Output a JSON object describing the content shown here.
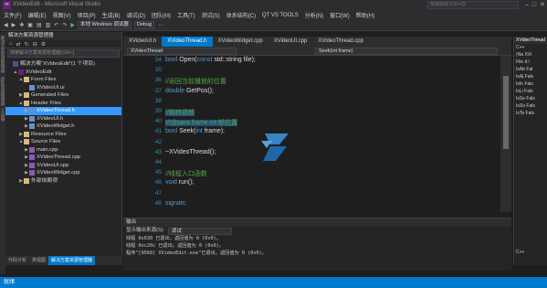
{
  "window": {
    "title": "XVideoEdit - Microsoft Visual Studio",
    "quick_launch_placeholder": "快速启动 (Ctrl+Q)"
  },
  "menu": [
    "文件(F)",
    "编辑(E)",
    "视图(V)",
    "项目(P)",
    "生成(B)",
    "调试(D)",
    "团队(M)",
    "工具(T)",
    "测试(S)",
    "体系结构(C)",
    "QT VS TOOLS",
    "分析(N)",
    "窗口(W)",
    "帮助(H)"
  ],
  "toolbar": {
    "debugger": "本地 Windows 调试器",
    "config": "Debug"
  },
  "left_strip": [
    "解决方案资源管理器",
    "团队资源管理器",
    "工具箱"
  ],
  "solution_explorer": {
    "header": "解决方案资源管理器",
    "search_placeholder": "搜索解决方案资源管理器(Ctrl+;)",
    "items": [
      {
        "label": "解决方案\"XVideoEdit\"(1 个项目)",
        "indent": 0,
        "icon": "sln",
        "arrow": ""
      },
      {
        "label": "XVideoEdit",
        "indent": 1,
        "icon": "proj",
        "arrow": "▲"
      },
      {
        "label": "Form Files",
        "indent": 2,
        "icon": "folder",
        "arrow": "▲"
      },
      {
        "label": "XVideoUI.ui",
        "indent": 3,
        "icon": "hfile",
        "arrow": ""
      },
      {
        "label": "Generated Files",
        "indent": 2,
        "icon": "folder",
        "arrow": "▶"
      },
      {
        "label": "Header Files",
        "indent": 2,
        "icon": "folder",
        "arrow": "▲"
      },
      {
        "label": "XVideoThread.h",
        "indent": 3,
        "icon": "hfile",
        "arrow": "▶",
        "selected": true
      },
      {
        "label": "XVideoUI.h",
        "indent": 3,
        "icon": "hfile",
        "arrow": "▶"
      },
      {
        "label": "XVideoWidget.h",
        "indent": 3,
        "icon": "hfile",
        "arrow": "▶"
      },
      {
        "label": "Resource Files",
        "indent": 2,
        "icon": "folder",
        "arrow": "▶"
      },
      {
        "label": "Source Files",
        "indent": 2,
        "icon": "folder",
        "arrow": "▲"
      },
      {
        "label": "main.cpp",
        "indent": 3,
        "icon": "cppfile",
        "arrow": "▶"
      },
      {
        "label": "XVideoThread.cpp",
        "indent": 3,
        "icon": "cppfile",
        "arrow": "▶"
      },
      {
        "label": "XVideoUI.cpp",
        "indent": 3,
        "icon": "cppfile",
        "arrow": "▶"
      },
      {
        "label": "XVideoWidget.cpp",
        "indent": 3,
        "icon": "cppfile",
        "arrow": "▶"
      },
      {
        "label": "外部依赖项",
        "indent": 2,
        "icon": "folder",
        "arrow": "▶"
      }
    ],
    "bottom_tabs": [
      "代码分析",
      "类视图",
      "解决方案资源管理器"
    ]
  },
  "tabs": [
    {
      "label": "XVideoUI.h",
      "active": false
    },
    {
      "label": "XVideoThread.h",
      "active": true
    },
    {
      "label": "XVideoWidget.cpp",
      "active": false
    },
    {
      "label": "XVideoUI.cpp",
      "active": false
    },
    {
      "label": "XVideoThread.cpp",
      "active": false
    }
  ],
  "navbar": {
    "scope": "XVideoThread",
    "member": "Seek(int frame)"
  },
  "code_lines": [
    {
      "n": "34",
      "segs": [
        [
          "kw",
          "bool "
        ],
        [
          "",
          "Open("
        ],
        [
          "kw",
          "const "
        ],
        [
          "",
          "std::string file);"
        ]
      ]
    },
    {
      "n": "35",
      "segs": [
        [
          "",
          ""
        ]
      ]
    },
    {
      "n": "36",
      "segs": [
        [
          "cm",
          "//返回当前播放的位置"
        ]
      ]
    },
    {
      "n": "37",
      "segs": [
        [
          "kw",
          "double "
        ],
        [
          "",
          "GetPos();"
        ]
      ]
    },
    {
      "n": "38",
      "segs": [
        [
          "",
          ""
        ]
      ]
    },
    {
      "n": "39",
      "segs": [
        [
          "cm",
          "//跳转视频"
        ]
      ],
      "hl": true
    },
    {
      "n": "40",
      "segs": [
        [
          "cm",
          "///@para frame int 帧位置"
        ]
      ],
      "hl": true
    },
    {
      "n": "41",
      "segs": [
        [
          "kw",
          "bool "
        ],
        [
          "",
          "Seek("
        ],
        [
          "kw",
          "int "
        ],
        [
          "",
          "frame);"
        ]
      ]
    },
    {
      "n": "42",
      "segs": [
        [
          "",
          ""
        ]
      ]
    },
    {
      "n": "43",
      "segs": [
        [
          "",
          "~XVideoThread();"
        ]
      ]
    },
    {
      "n": "44",
      "segs": [
        [
          "",
          ""
        ]
      ]
    },
    {
      "n": "45",
      "segs": [
        [
          "cm",
          "//线程入口函数"
        ]
      ]
    },
    {
      "n": "46",
      "segs": [
        [
          "kw",
          "void "
        ],
        [
          "",
          "run();"
        ]
      ]
    },
    {
      "n": "47",
      "segs": [
        [
          "",
          ""
        ]
      ]
    },
    {
      "n": "48",
      "segs": [
        [
          "kw",
          "signals:"
        ]
      ]
    }
  ],
  "output": {
    "header": "输出",
    "source_label": "显示输出来源(S):",
    "source_value": "调试",
    "lines": [
      "线程 0x630 已退出，返回值为 0 (0x0)。",
      "线程 0xc20c 已退出，返回值为 0 (0x0)。",
      "程序\"[9560] XVideoEdit.exe\"已退出，返回值为 0 (0x0)。"
    ]
  },
  "right_panel": {
    "header": "XVideoThread",
    "items": [
      "C++",
      "(Na XVi",
      "File d:\\",
      "IsAb Fal",
      "IsAj Fals",
      "IsIn Fals",
      "IsLi Fals",
      "IsSe Fals",
      "IsSo Fals",
      "IsTe Fals"
    ],
    "footer": "C++"
  },
  "statusbar": {
    "text": "就绪"
  }
}
